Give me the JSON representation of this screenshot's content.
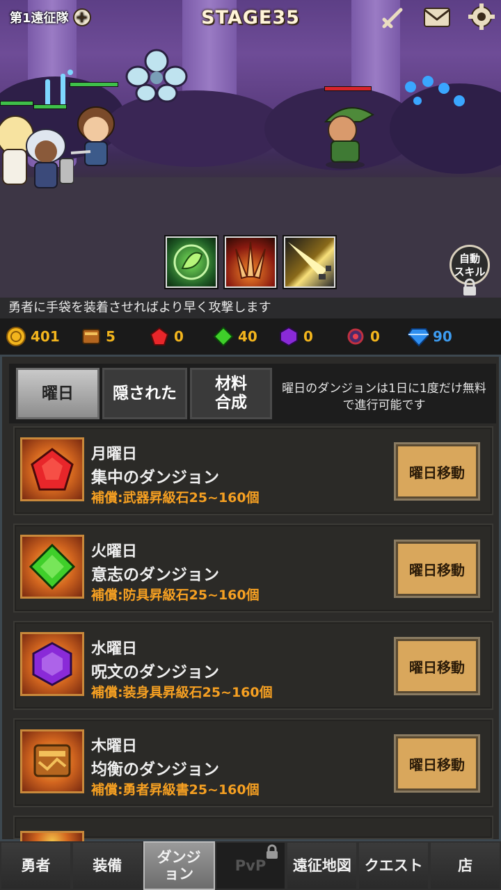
{
  "hud": {
    "party_label": "第1遠征隊",
    "stage": "STAGE35"
  },
  "icons": {
    "add": "plus-circle-icon",
    "sword": "sword-icon",
    "mail": "mail-icon",
    "settings": "gear-icon",
    "lock": "lock-icon"
  },
  "auto_skill": {
    "line1": "自動",
    "line2": "スキル"
  },
  "tip": "勇者に手袋を装着させればより早く攻撃します",
  "resources": [
    {
      "name": "gold",
      "value": "401",
      "color": "#f3b51d"
    },
    {
      "name": "book",
      "value": "5",
      "color": "#f3b51d"
    },
    {
      "name": "red-gem",
      "value": "0",
      "color": "#f3b51d"
    },
    {
      "name": "green-gem",
      "value": "40",
      "color": "#f3b51d"
    },
    {
      "name": "purple-gem",
      "value": "0",
      "color": "#f3b51d"
    },
    {
      "name": "dark-orb",
      "value": "0",
      "color": "#f3b51d"
    },
    {
      "name": "diamond",
      "value": "90",
      "color": "#3d9cf0"
    }
  ],
  "tabs": {
    "daily": "曜日",
    "hidden": "隠された",
    "material_line1": "材料",
    "material_line2": "合成"
  },
  "description": "曜日のダンジョンは1日に1度だけ無料で進行可能です",
  "dungeons": [
    {
      "day": "月曜日",
      "name": "集中のダンジョン",
      "reward": "補償:武器昇級石25~160個",
      "button": "曜日移動",
      "icon": "red-gem-icon"
    },
    {
      "day": "火曜日",
      "name": "意志のダンジョン",
      "reward": "補償:防具昇級石25~160個",
      "button": "曜日移動",
      "icon": "green-gem-icon"
    },
    {
      "day": "水曜日",
      "name": "呪文のダンジョン",
      "reward": "補償:装身具昇級石25~160個",
      "button": "曜日移動",
      "icon": "purple-gem-icon"
    },
    {
      "day": "木曜日",
      "name": "均衡のダンジョン",
      "reward": "補償:勇者昇級書25~160個",
      "button": "曜日移動",
      "icon": "book-icon"
    }
  ],
  "nav": {
    "heroes": "勇者",
    "equipment": "装備",
    "dungeon_line1": "ダンジ",
    "dungeon_line2": "ョン",
    "pvp": "PvP",
    "expedition_map": "遠征地図",
    "quest": "クエスト",
    "shop": "店"
  },
  "hp": {
    "hero1": 1.0,
    "hero2": 1.0,
    "hero3": 1.0,
    "enemy": 1.0
  }
}
